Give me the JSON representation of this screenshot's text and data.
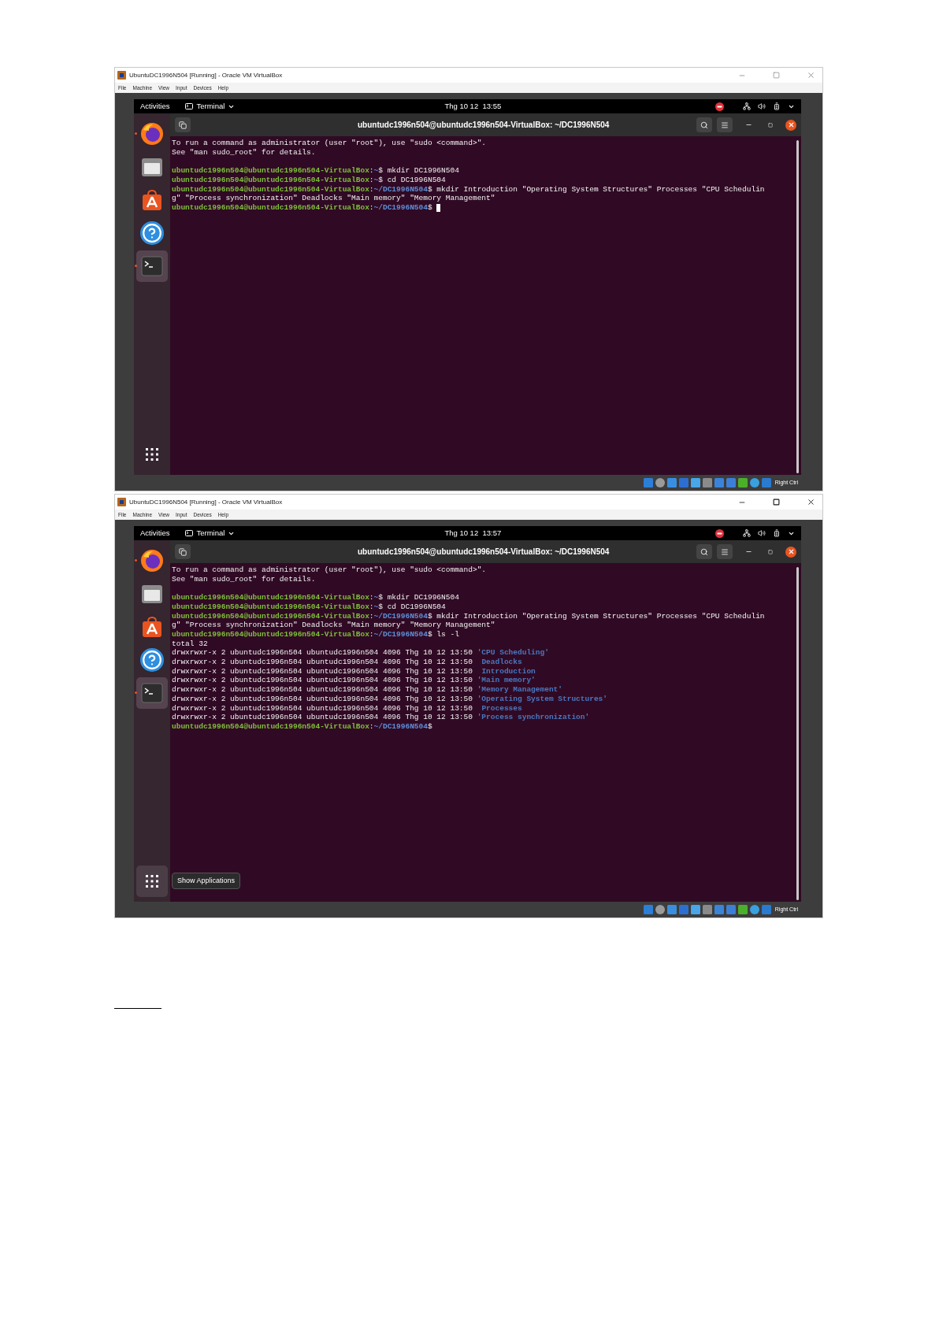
{
  "windows": [
    {
      "title": "UbuntuDC1996N504 [Running] - Oracle VM VirtualBox",
      "focused": false,
      "menu": [
        "File",
        "Machine",
        "View",
        "Input",
        "Devices",
        "Help"
      ],
      "topbar": {
        "activities": "Activities",
        "app": "Terminal",
        "clock": "Thg 10 12  13:55"
      },
      "dock": [
        {
          "kind": "firefox",
          "running": true,
          "selected": false
        },
        {
          "kind": "files",
          "running": false,
          "selected": false
        },
        {
          "kind": "software",
          "running": false,
          "selected": false
        },
        {
          "kind": "help",
          "running": false,
          "selected": false
        },
        {
          "kind": "terminal",
          "running": true,
          "selected": true
        }
      ],
      "terminal": {
        "title": "ubuntudc1996n504@ubuntudc1996n504-VirtualBox: ~/DC1996N504",
        "cursor": true,
        "lines": [
          {
            "kind": "text",
            "segments": [
              {
                "kind": "text",
                "text": "To run a command as administrator (user \"root\"), use \"sudo <command>\"."
              }
            ]
          },
          {
            "kind": "text",
            "segments": [
              {
                "kind": "text",
                "text": "See \"man sudo_root\" for details."
              }
            ]
          },
          {
            "kind": "blank"
          },
          {
            "kind": "text",
            "segments": [
              {
                "kind": "user",
                "text": "ubuntudc1996n504@ubuntudc1996n504-VirtualBox"
              },
              {
                "kind": "text",
                "text": ":"
              },
              {
                "kind": "path",
                "text": "~"
              },
              {
                "kind": "text",
                "text": "$ mkdir DC1996N504"
              }
            ]
          },
          {
            "kind": "text",
            "segments": [
              {
                "kind": "user",
                "text": "ubuntudc1996n504@ubuntudc1996n504-VirtualBox"
              },
              {
                "kind": "text",
                "text": ":"
              },
              {
                "kind": "path",
                "text": "~"
              },
              {
                "kind": "text",
                "text": "$ cd DC1996N504"
              }
            ]
          },
          {
            "kind": "text",
            "segments": [
              {
                "kind": "user",
                "text": "ubuntudc1996n504@ubuntudc1996n504-VirtualBox"
              },
              {
                "kind": "text",
                "text": ":"
              },
              {
                "kind": "path",
                "text": "~/DC1996N504"
              },
              {
                "kind": "text",
                "text": "$ mkdir Introduction \"Operating System Structures\" Processes \"CPU Schedulin"
              }
            ]
          },
          {
            "kind": "text",
            "segments": [
              {
                "kind": "text",
                "text": "g\" \"Process synchronization\" Deadlocks \"Main memory\" \"Memory Management\""
              }
            ]
          },
          {
            "kind": "text",
            "segments": [
              {
                "kind": "user",
                "text": "ubuntudc1996n504@ubuntudc1996n504-VirtualBox"
              },
              {
                "kind": "text",
                "text": ":"
              },
              {
                "kind": "path",
                "text": "~/DC1996N504"
              },
              {
                "kind": "text",
                "text": "$ "
              }
            ]
          }
        ]
      },
      "host_key": "Right Ctrl"
    },
    {
      "title": "UbuntuDC1996N504 [Running] - Oracle VM VirtualBox",
      "focused": true,
      "menu": [
        "File",
        "Machine",
        "View",
        "Input",
        "Devices",
        "Help"
      ],
      "topbar": {
        "activities": "Activities",
        "app": "Terminal",
        "clock": "Thg 10 12  13:57"
      },
      "dock": [
        {
          "kind": "firefox",
          "running": true,
          "selected": false
        },
        {
          "kind": "files",
          "running": false,
          "selected": false
        },
        {
          "kind": "software",
          "running": false,
          "selected": false
        },
        {
          "kind": "help",
          "running": false,
          "selected": false
        },
        {
          "kind": "terminal",
          "running": true,
          "selected": true
        }
      ],
      "show_apps_tooltip": "Show Applications",
      "terminal": {
        "title": "ubuntudc1996n504@ubuntudc1996n504-VirtualBox: ~/DC1996N504",
        "cursor": false,
        "lines": [
          {
            "kind": "text",
            "segments": [
              {
                "kind": "text",
                "text": "To run a command as administrator (user \"root\"), use \"sudo <command>\"."
              }
            ]
          },
          {
            "kind": "text",
            "segments": [
              {
                "kind": "text",
                "text": "See \"man sudo_root\" for details."
              }
            ]
          },
          {
            "kind": "blank"
          },
          {
            "kind": "text",
            "segments": [
              {
                "kind": "user",
                "text": "ubuntudc1996n504@ubuntudc1996n504-VirtualBox"
              },
              {
                "kind": "text",
                "text": ":"
              },
              {
                "kind": "path",
                "text": "~"
              },
              {
                "kind": "text",
                "text": "$ mkdir DC1996N504"
              }
            ]
          },
          {
            "kind": "text",
            "segments": [
              {
                "kind": "user",
                "text": "ubuntudc1996n504@ubuntudc1996n504-VirtualBox"
              },
              {
                "kind": "text",
                "text": ":"
              },
              {
                "kind": "path",
                "text": "~"
              },
              {
                "kind": "text",
                "text": "$ cd DC1996N504"
              }
            ]
          },
          {
            "kind": "text",
            "segments": [
              {
                "kind": "user",
                "text": "ubuntudc1996n504@ubuntudc1996n504-VirtualBox"
              },
              {
                "kind": "text",
                "text": ":"
              },
              {
                "kind": "path",
                "text": "~/DC1996N504"
              },
              {
                "kind": "text",
                "text": "$ mkdir Introduction \"Operating System Structures\" Processes \"CPU Schedulin"
              }
            ]
          },
          {
            "kind": "text",
            "segments": [
              {
                "kind": "text",
                "text": "g\" \"Process synchronization\" Deadlocks \"Main memory\" \"Memory Management\""
              }
            ]
          },
          {
            "kind": "text",
            "segments": [
              {
                "kind": "user",
                "text": "ubuntudc1996n504@ubuntudc1996n504-VirtualBox"
              },
              {
                "kind": "text",
                "text": ":"
              },
              {
                "kind": "path",
                "text": "~/DC1996N504"
              },
              {
                "kind": "text",
                "text": "$ ls -l"
              }
            ]
          },
          {
            "kind": "text",
            "segments": [
              {
                "kind": "text",
                "text": "total 32"
              }
            ]
          },
          {
            "kind": "text",
            "segments": [
              {
                "kind": "text",
                "text": "drwxrwxr-x 2 ubuntudc1996n504 ubuntudc1996n504 4096 Thg 10 12 13:50 "
              },
              {
                "kind": "dir",
                "text": "'CPU Scheduling'"
              }
            ]
          },
          {
            "kind": "text",
            "segments": [
              {
                "kind": "text",
                "text": "drwxrwxr-x 2 ubuntudc1996n504 ubuntudc1996n504 4096 Thg 10 12 13:50  "
              },
              {
                "kind": "dir",
                "text": "Deadlocks"
              }
            ]
          },
          {
            "kind": "text",
            "segments": [
              {
                "kind": "text",
                "text": "drwxrwxr-x 2 ubuntudc1996n504 ubuntudc1996n504 4096 Thg 10 12 13:50  "
              },
              {
                "kind": "dir",
                "text": "Introduction"
              }
            ]
          },
          {
            "kind": "text",
            "segments": [
              {
                "kind": "text",
                "text": "drwxrwxr-x 2 ubuntudc1996n504 ubuntudc1996n504 4096 Thg 10 12 13:50 "
              },
              {
                "kind": "dir",
                "text": "'Main memory'"
              }
            ]
          },
          {
            "kind": "text",
            "segments": [
              {
                "kind": "text",
                "text": "drwxrwxr-x 2 ubuntudc1996n504 ubuntudc1996n504 4096 Thg 10 12 13:50 "
              },
              {
                "kind": "dir",
                "text": "'Memory Management'"
              }
            ]
          },
          {
            "kind": "text",
            "segments": [
              {
                "kind": "text",
                "text": "drwxrwxr-x 2 ubuntudc1996n504 ubuntudc1996n504 4096 Thg 10 12 13:50 "
              },
              {
                "kind": "dir",
                "text": "'Operating System Structures'"
              }
            ]
          },
          {
            "kind": "text",
            "segments": [
              {
                "kind": "text",
                "text": "drwxrwxr-x 2 ubuntudc1996n504 ubuntudc1996n504 4096 Thg 10 12 13:50  "
              },
              {
                "kind": "dir",
                "text": "Processes"
              }
            ]
          },
          {
            "kind": "text",
            "segments": [
              {
                "kind": "text",
                "text": "drwxrwxr-x 2 ubuntudc1996n504 ubuntudc1996n504 4096 Thg 10 12 13:50 "
              },
              {
                "kind": "dir",
                "text": "'Process synchronization'"
              }
            ]
          },
          {
            "kind": "text",
            "segments": [
              {
                "kind": "user",
                "text": "ubuntudc1996n504@ubuntudc1996n504-VirtualBox"
              },
              {
                "kind": "text",
                "text": ":"
              },
              {
                "kind": "path",
                "text": "~/DC1996N504"
              },
              {
                "kind": "text",
                "text": "$ "
              }
            ]
          }
        ]
      },
      "host_key": "Right Ctrl"
    }
  ]
}
